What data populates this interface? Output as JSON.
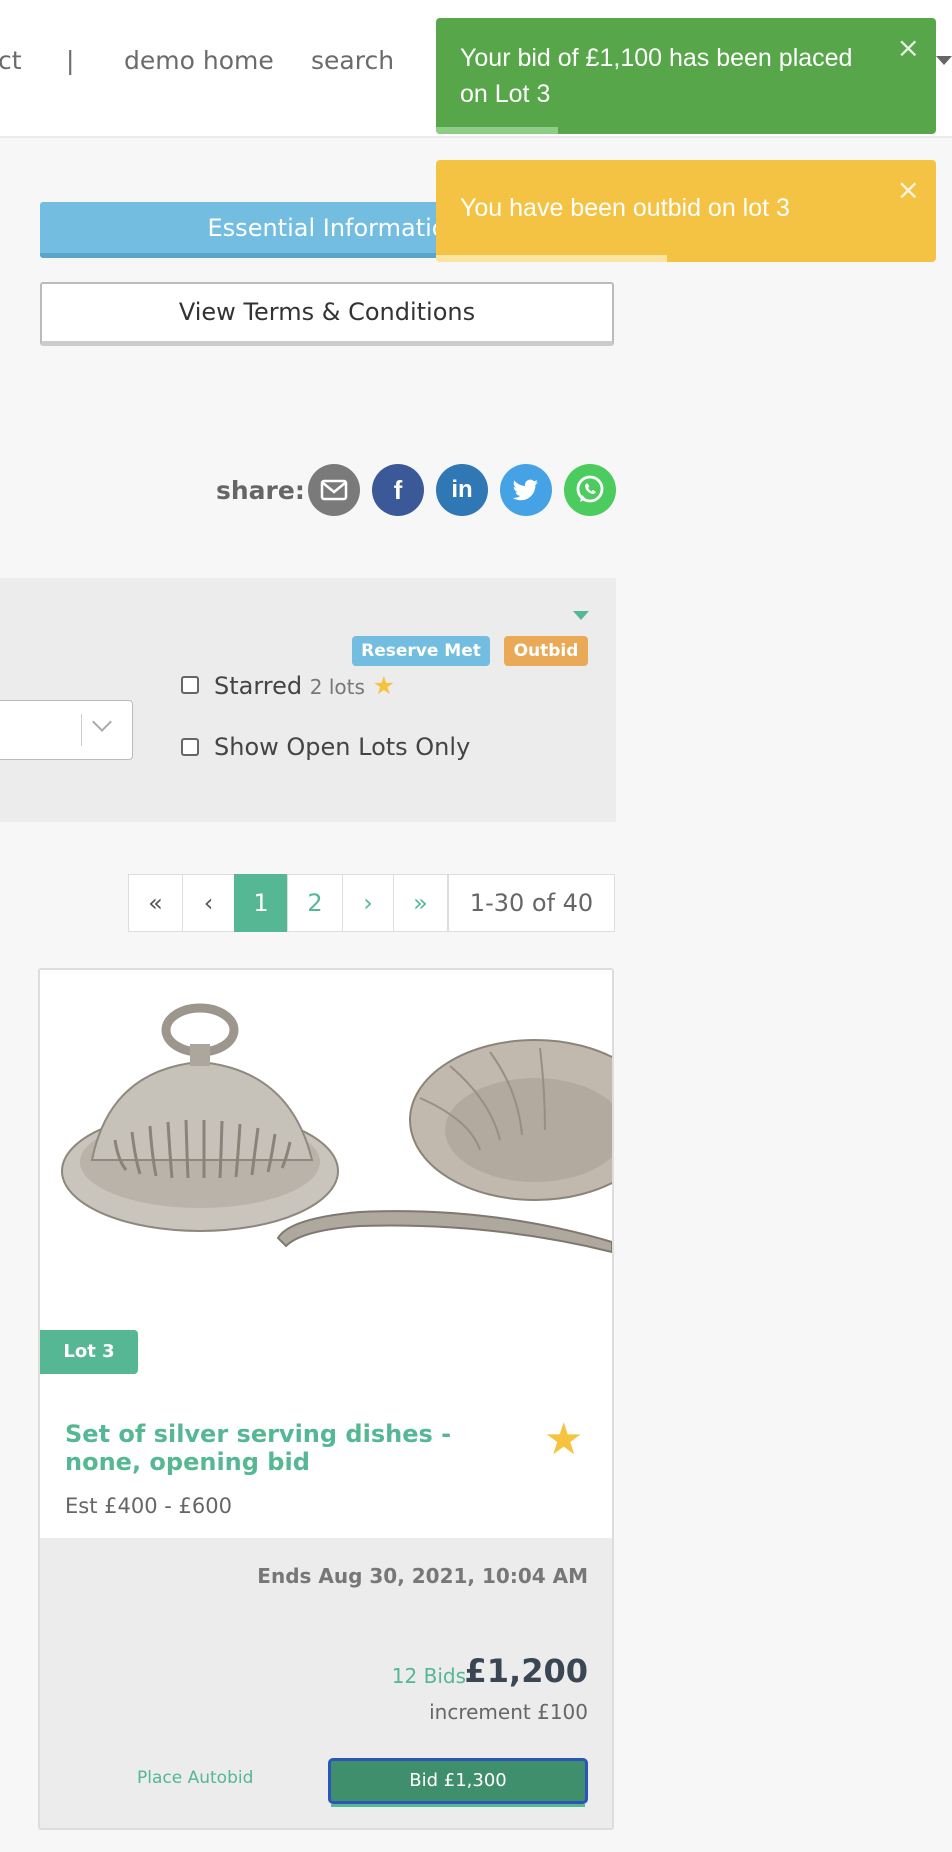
{
  "nav": {
    "partial_item": "ct",
    "separator": "|",
    "demo_home": "demo home",
    "search": "search"
  },
  "toasts": [
    {
      "message": "Your bid of £1,100 has been placed on Lot 3",
      "close": "×",
      "color": "#57a64a"
    },
    {
      "message": "You have been outbid on lot 3",
      "close": "×",
      "color": "#f5c343"
    }
  ],
  "buttons": {
    "essential_info": "Essential Informatio",
    "terms": "View Terms & Conditions"
  },
  "share": {
    "label": "share:",
    "icons": [
      "email-icon",
      "facebook-icon",
      "linkedin-icon",
      "twitter-icon",
      "whatsapp-icon"
    ]
  },
  "filters": {
    "starred_label": "Starred",
    "starred_count": "2 lots",
    "open_lots_label": "Show Open Lots Only"
  },
  "pagination": {
    "first": "«",
    "prev": "‹",
    "pages": [
      "1",
      "2"
    ],
    "current_page": "1",
    "next": "›",
    "last": "»",
    "range": "1-30 of 40"
  },
  "lot": {
    "badge": "Lot 3",
    "title": "Set of silver serving dishes - none, opening bid",
    "estimate": "Est £400 - £600",
    "ends": "Ends Aug 30, 2021, 10:04 AM",
    "status_badges": [
      "Reserve Met",
      "Outbid"
    ],
    "bids": "12 Bids",
    "price": "£1,200",
    "increment": "increment £100",
    "autobid": "Place Autobid",
    "bid_button": "Bid £1,300",
    "starred": true
  },
  "colors": {
    "accent": "#55b794",
    "info": "#72bde0",
    "warning": "#e9a956",
    "star": "#f6c33f"
  }
}
